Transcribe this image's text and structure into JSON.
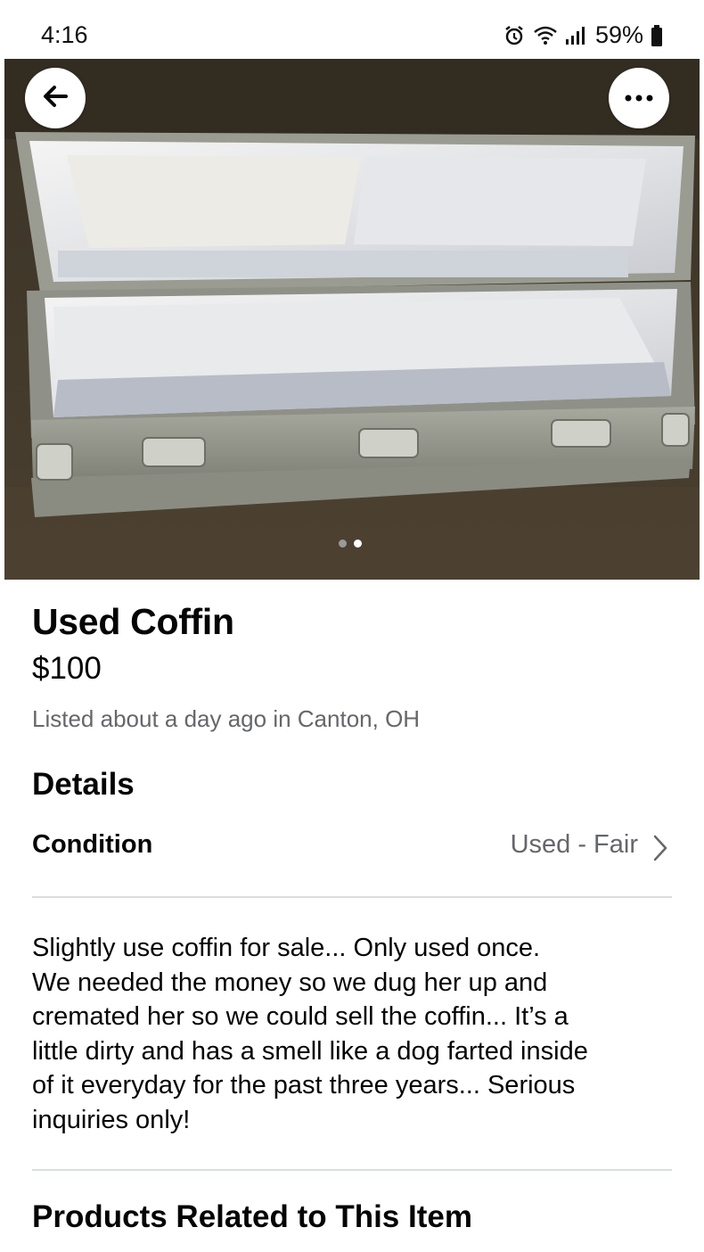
{
  "status_bar": {
    "time": "4:16",
    "battery": "59%",
    "icons": [
      "alarm-icon",
      "wifi-icon",
      "signal-icon",
      "battery-icon"
    ]
  },
  "photo": {
    "alt": "coffin-photo",
    "pager": {
      "count": 2,
      "active_index": 1
    }
  },
  "listing": {
    "title": "Used Coffin",
    "price": "$100",
    "meta": "Listed about a day ago in Canton, OH"
  },
  "details": {
    "heading": "Details",
    "condition_label": "Condition",
    "condition_value": "Used - Fair"
  },
  "description": "Slightly use coffin for sale... Only used once.\nWe needed the money so we dug her up and\ncremated her so we could sell the coffin... It’s a\nlittle dirty and has a smell like a dog farted inside\nof it everyday for the past three years... Serious\ninquiries only!",
  "related": {
    "heading": "Products Related to This Item"
  },
  "colors": {
    "text": "#050505",
    "secondary_text": "#65676b",
    "divider": "#dadde1"
  }
}
